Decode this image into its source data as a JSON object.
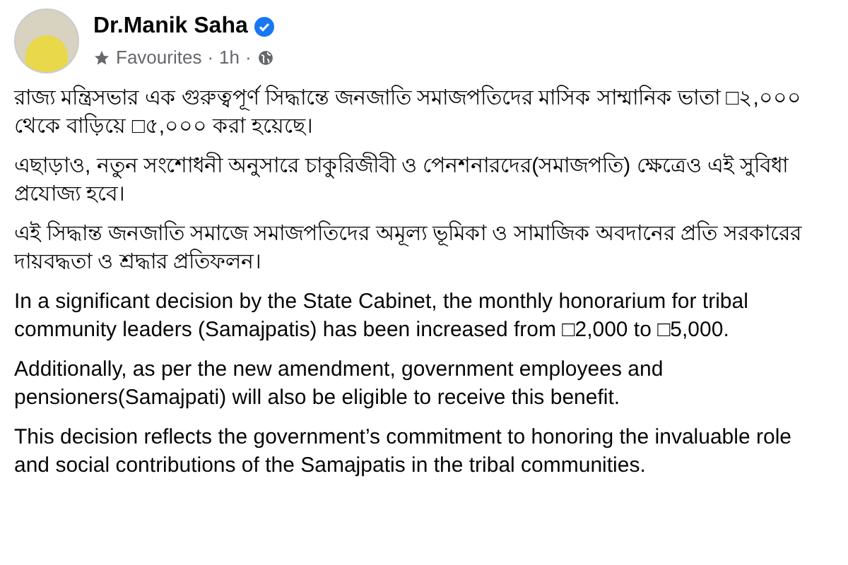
{
  "post": {
    "author": "Dr.Manik Saha",
    "verified": true,
    "audience_label": "Favourites",
    "separator_1": "·",
    "time": "1h",
    "separator_2": "·",
    "paragraphs": [
      "রাজ্য মন্ত্রিসভার এক গুরুত্বপূর্ণ সিদ্ধান্তে জনজাতি সমাজপতিদের মাসিক সাম্মানিক ভাতা □২,০০০ থেকে বাড়িয়ে □৫,০০০ করা হয়েছে।",
      "এছাড়াও, নতুন সংশোধনী অনুসারে চাকুরিজীবী ও পেনশনারদের(সমাজপতি) ক্ষেত্রেও এই সুবিধা প্রযোজ্য হবে।",
      "এই সিদ্ধান্ত জনজাতি সমাজে সমাজপতিদের অমূল্য ভূমিকা ও সামাজিক অবদানের প্রতি সরকারের দায়বদ্ধতা ও শ্রদ্ধার প্রতিফলন।",
      "In a significant decision by the State Cabinet, the monthly honorarium for tribal community leaders (Samajpatis) has been increased from □2,000 to □5,000.",
      "Additionally, as per the new amendment, government employees and pensioners(Samajpati) will also be eligible to receive this benefit.",
      "This decision reflects the government’s commitment to honoring the invaluable role and social contributions of the Samajpatis in the tribal communities."
    ]
  }
}
